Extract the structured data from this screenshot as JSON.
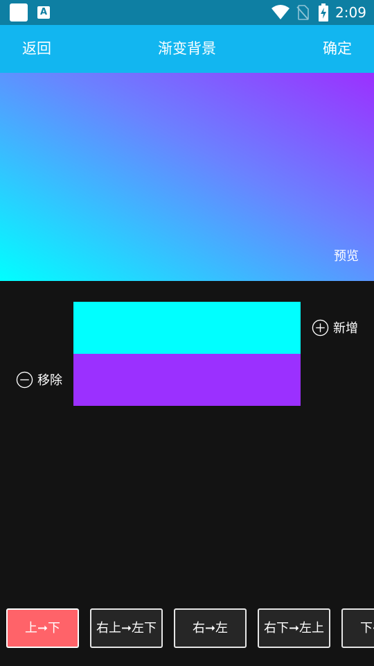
{
  "status_bar": {
    "time": "2:09",
    "icons": [
      "app-square-icon",
      "accessibility-a-icon",
      "wifi-icon",
      "no-sim-icon",
      "battery-charging-icon"
    ]
  },
  "toolbar": {
    "back_label": "返回",
    "title": "渐变背景",
    "confirm_label": "确定"
  },
  "preview": {
    "label": "预览",
    "gradient_colors": [
      "#00ffff",
      "#9b30ff"
    ]
  },
  "editor": {
    "add_label": "新增",
    "remove_label": "移除",
    "colors": [
      "#00ffff",
      "#9b30ff"
    ]
  },
  "directions": {
    "items": [
      "上➞下",
      "右上➞左下",
      "右➞左",
      "右下➞左上",
      "下➞上"
    ],
    "selected": "上➞下"
  },
  "colors": {
    "status_bar_bg": "#0e7fa3",
    "toolbar_bg": "#12b6f0",
    "page_bg": "#131313",
    "active_button": "#ff6369"
  }
}
